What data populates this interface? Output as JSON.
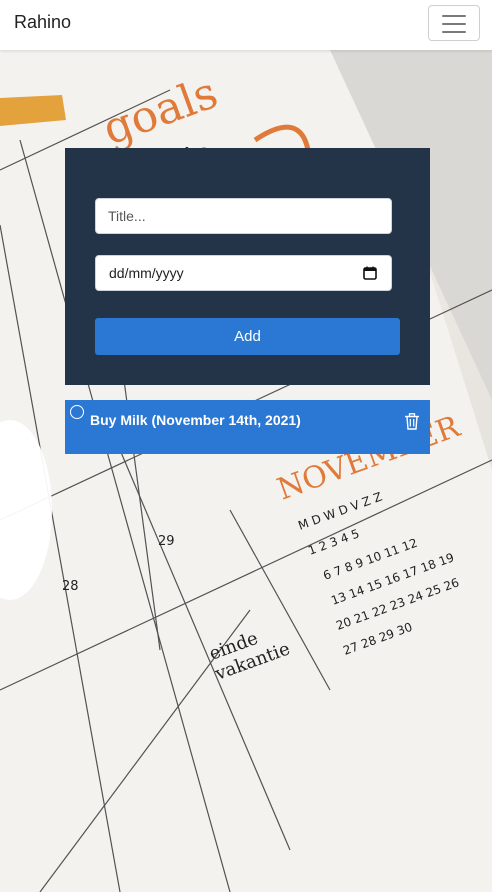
{
  "navbar": {
    "brand": "Rahino",
    "toggler_icon": "hamburger-menu-icon"
  },
  "form": {
    "title_placeholder": "Title...",
    "date_value": "dd/mm/yyyy",
    "calendar_icon": "calendar-icon",
    "add_label": "Add"
  },
  "todos": [
    {
      "label": "Buy Milk (November 14th, 2021)",
      "done": false,
      "delete_icon": "trash-icon"
    }
  ],
  "colors": {
    "card_bg": "#233449",
    "accent": "#2a78d3",
    "navbar_bg": "#ffffff"
  }
}
